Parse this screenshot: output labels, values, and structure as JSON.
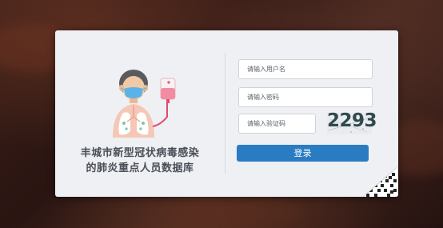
{
  "title_line1": "丰城市新型冠状病毒感染",
  "title_line2": "的肺炎重点人员数据库",
  "username": {
    "placeholder": "请输入用户名",
    "value": ""
  },
  "password": {
    "placeholder": "请输入密码",
    "value": ""
  },
  "captcha": {
    "placeholder": "请输入验证码",
    "value": "",
    "code": "2293"
  },
  "login_button": "登录",
  "colors": {
    "accent": "#2a7cc2",
    "card": "#eef0f3",
    "title": "#4a4f57"
  },
  "icons": {
    "illustration": "doctor-lungs-iv-icon",
    "corner": "qr-code-corner-icon"
  }
}
